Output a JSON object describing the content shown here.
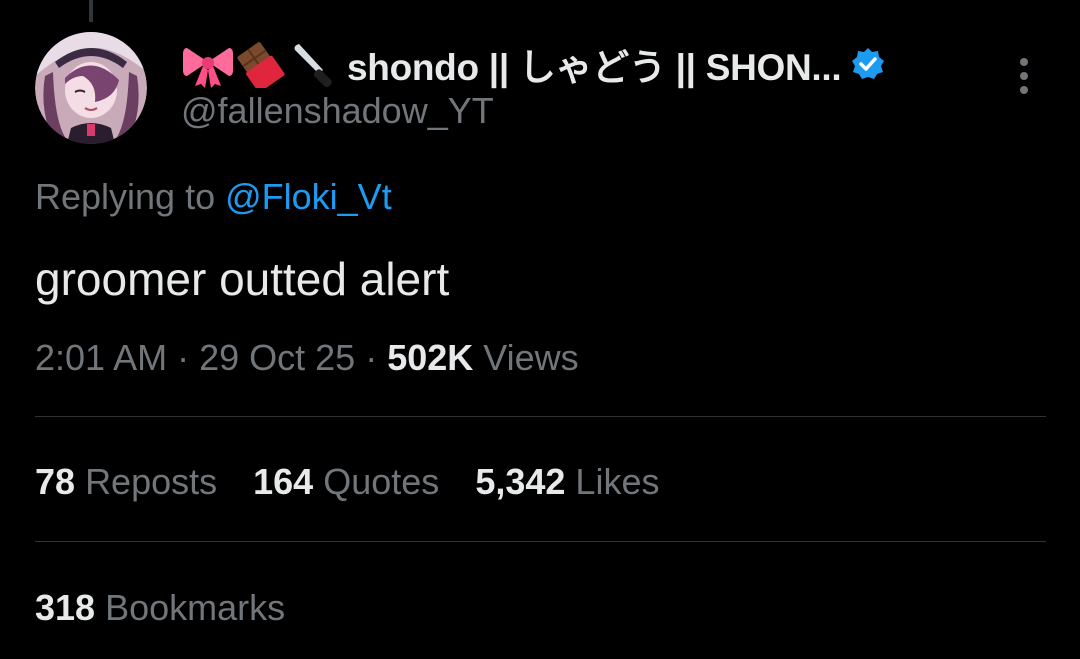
{
  "author": {
    "emojis": [
      "ribbon-icon",
      "chocolate-bar-icon",
      "knife-icon"
    ],
    "display_name": "shondo || しゃどう || SHON...",
    "handle": "@fallenshadow_YT",
    "verified": true
  },
  "reply": {
    "prefix": "Replying to ",
    "mention": "@Floki_Vt"
  },
  "tweet": {
    "text": "groomer outted alert"
  },
  "meta": {
    "time": "2:01 AM",
    "separator": " · ",
    "date": "29 Oct 25",
    "views_count": "502K",
    "views_label": "Views"
  },
  "stats": {
    "reposts": {
      "count": "78",
      "label": "Reposts"
    },
    "quotes": {
      "count": "164",
      "label": "Quotes"
    },
    "likes": {
      "count": "5,342",
      "label": "Likes"
    },
    "bookmarks": {
      "count": "318",
      "label": "Bookmarks"
    }
  },
  "colors": {
    "background": "#000000",
    "text_primary": "#e7e9ea",
    "text_secondary": "#71767b",
    "accent": "#1d9bf0",
    "divider": "#2f3336"
  }
}
